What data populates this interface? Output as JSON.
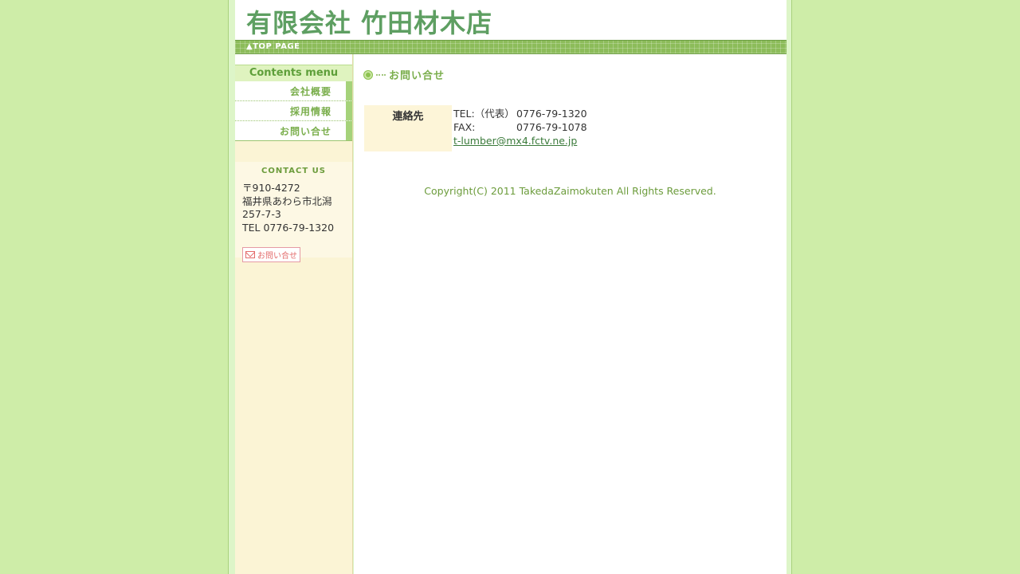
{
  "site": {
    "title": "有限会社 竹田材木店"
  },
  "nav": {
    "top_page": "▲TOP PAGE"
  },
  "sidebar": {
    "menu_title": "Contents menu",
    "items": [
      {
        "label": "会社概要"
      },
      {
        "label": "採用情報"
      },
      {
        "label": "お問い合せ"
      }
    ],
    "contact": {
      "title": "CONTACT US",
      "postal": "〒910-4272",
      "address1": "福井県あわら市北潟",
      "address2": "257-7-3",
      "tel": "TEL 0776-79-1320",
      "button_label": "お問い合せ"
    }
  },
  "main": {
    "heading": "お問い合せ",
    "contact_table": {
      "header": "連絡先",
      "tel_label": "TEL:（代表）",
      "tel_value": "0776-79-1320",
      "fax_label": "FAX:",
      "fax_value": "0776-79-1078",
      "email": "t-lumber@mx4.fctv.ne.jp"
    },
    "copyright": "Copyright(C) 2011 TakedaZaimokuten All Rights Reserved."
  },
  "colors": {
    "background": "#ceeda8",
    "title_green": "#5e9f62",
    "accent_green": "#7aae4c",
    "sidebar_bg": "#fbf4d5"
  }
}
